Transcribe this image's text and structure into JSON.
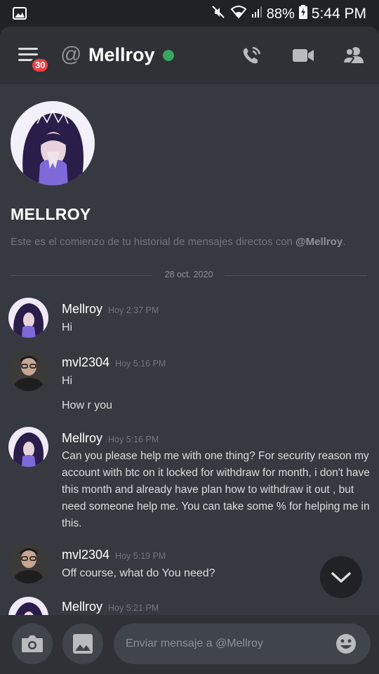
{
  "status_bar": {
    "battery_percent": "88%",
    "time": "5:44 PM"
  },
  "header": {
    "menu_badge": "30",
    "title": "Mellroy",
    "online_color": "#3ba55d"
  },
  "intro": {
    "name": "MELLROY",
    "text_prefix": "Este es el comienzo de tu historial de mensajes directos con ",
    "mention": "@Mellroy",
    "text_suffix": "."
  },
  "date_divider": "28 oct. 2020",
  "messages": [
    {
      "author": "Mellroy",
      "time": "Hoy 2:37 PM",
      "lines": [
        "Hi"
      ]
    },
    {
      "author": "mvl2304",
      "time": "Hoy 5:16 PM",
      "lines": [
        "Hi",
        "How r you"
      ]
    },
    {
      "author": "Mellroy",
      "time": "Hoy 5:16 PM",
      "lines": [
        "Can you please help me with one thing? For security reason my account with btc on it locked for withdraw for month, i don't have this month and already have plan how to withdraw it out , but need someone help me. You can take some % for helping me in this."
      ]
    },
    {
      "author": "mvl2304",
      "time": "Hoy 5:19 PM",
      "lines": [
        "Off course, what do You need?"
      ]
    },
    {
      "author": "Mellroy",
      "time": "Hoy 5:21 PM",
      "lines": []
    }
  ],
  "composer": {
    "placeholder": "Enviar mensaje a @Mellroy"
  }
}
